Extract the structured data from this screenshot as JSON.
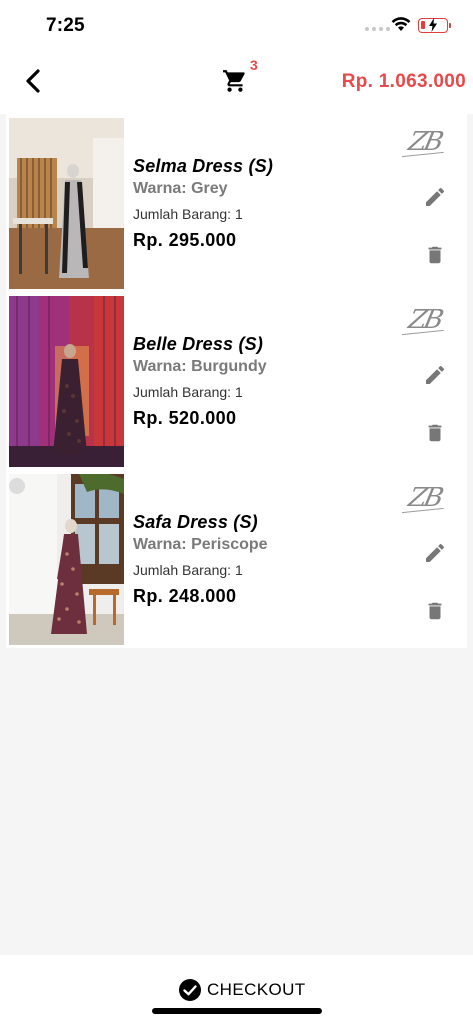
{
  "status_bar": {
    "time": "7:25"
  },
  "header": {
    "back_icon": "chevron-left-icon",
    "cart_icon": "shopping-cart-icon",
    "cart_count": "3",
    "total": "Rp. 1.063.000",
    "accent_color": "#e8494a"
  },
  "brand": {
    "logo_text": "ZB"
  },
  "items": [
    {
      "name": "Selma Dress (S)",
      "color": "Warna: Grey",
      "quantity": "Jumlah Barang: 1",
      "price": "Rp. 295.000"
    },
    {
      "name": "Belle Dress (S)",
      "color": "Warna: Burgundy",
      "quantity": "Jumlah Barang: 1",
      "price": "Rp. 520.000"
    },
    {
      "name": "Safa Dress (S)",
      "color": "Warna: Periscope",
      "quantity": "Jumlah Barang: 1",
      "price": "Rp. 248.000"
    }
  ],
  "item_actions": {
    "edit_icon": "pencil-icon",
    "delete_icon": "trash-icon"
  },
  "footer": {
    "checkout_label": "CHECKOUT",
    "checkout_icon": "check-circle-icon"
  }
}
